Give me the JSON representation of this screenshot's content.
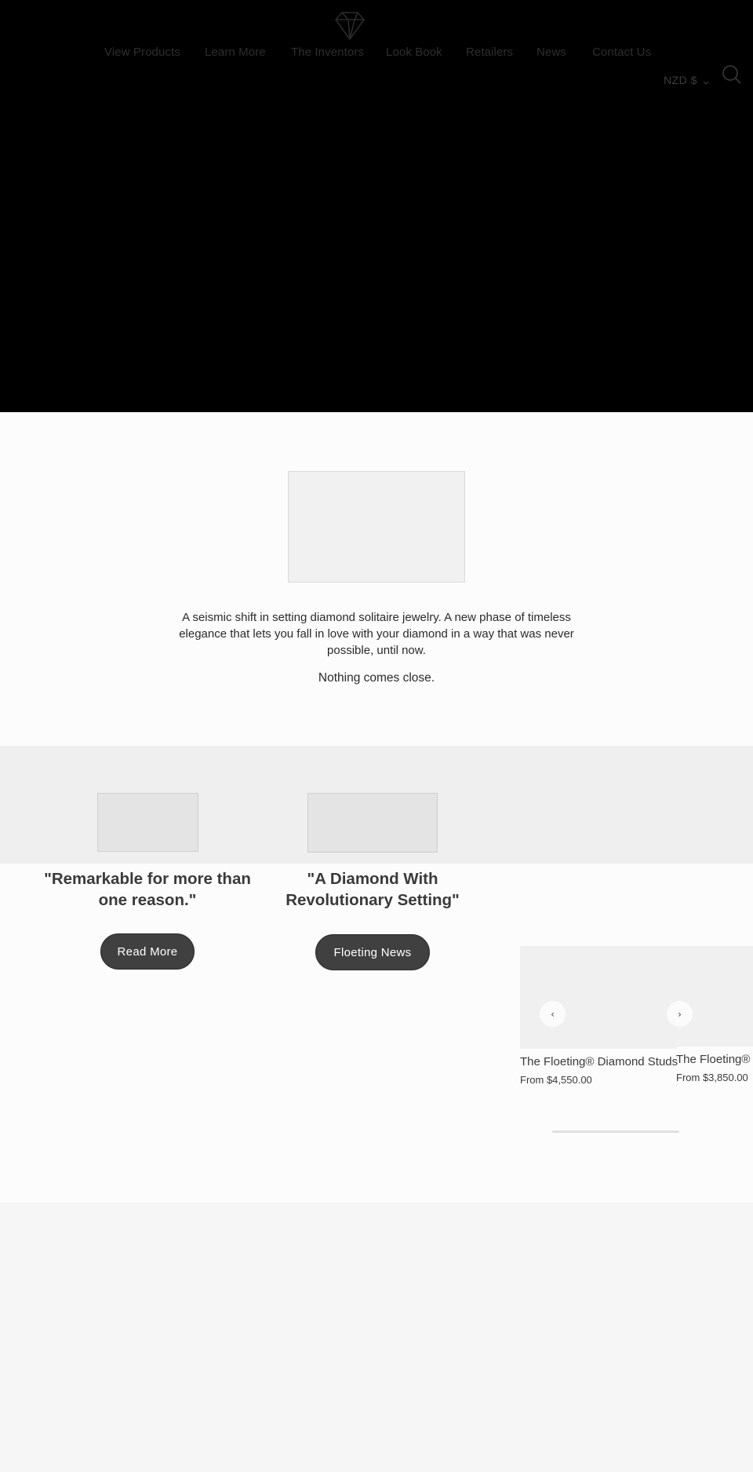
{
  "header": {
    "logo": "diamond-logo",
    "nav": [
      {
        "label": "View Products"
      },
      {
        "label": "Learn More"
      },
      {
        "label": "The Inventors"
      },
      {
        "label": "Look Book"
      },
      {
        "label": "Retailers"
      },
      {
        "label": "News"
      },
      {
        "label": "Contact Us"
      }
    ],
    "currency": "NZD $",
    "search_icon": "search-icon"
  },
  "intro": {
    "body": "A seismic shift in setting diamond solitaire jewelry. A new phase of timeless elegance that lets you fall in love with your diamond in a way that was never possible, until now.",
    "tagline": "Nothing comes close."
  },
  "press": [
    {
      "quote": "\"Remarkable for more than one reason.\"",
      "button": "Read More"
    },
    {
      "quote": "\"A Diamond With Revolutionary Setting\"",
      "button": "Floeting News"
    }
  ],
  "products": {
    "prev_icon": "‹",
    "next_icon": "›",
    "items": [
      {
        "title": "The Floeting® Diamond Studs",
        "price": "From $4,550.00"
      },
      {
        "title": "The Floeting® Diamond Pendant",
        "price": "From $3,850.00"
      }
    ]
  },
  "colors": {
    "hero_bg": "#000000",
    "button_bg": "#414040",
    "section_gray": "#efefef",
    "text": "#3a3a3a"
  }
}
